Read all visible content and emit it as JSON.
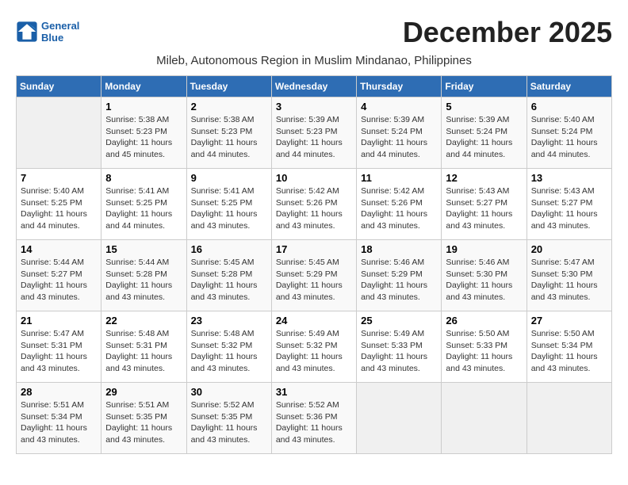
{
  "logo": {
    "line1": "General",
    "line2": "Blue"
  },
  "title": "December 2025",
  "subtitle": "Mileb, Autonomous Region in Muslim Mindanao, Philippines",
  "days_of_week": [
    "Sunday",
    "Monday",
    "Tuesday",
    "Wednesday",
    "Thursday",
    "Friday",
    "Saturday"
  ],
  "weeks": [
    [
      {
        "day": "",
        "info": ""
      },
      {
        "day": "1",
        "info": "Sunrise: 5:38 AM\nSunset: 5:23 PM\nDaylight: 11 hours\nand 45 minutes."
      },
      {
        "day": "2",
        "info": "Sunrise: 5:38 AM\nSunset: 5:23 PM\nDaylight: 11 hours\nand 44 minutes."
      },
      {
        "day": "3",
        "info": "Sunrise: 5:39 AM\nSunset: 5:23 PM\nDaylight: 11 hours\nand 44 minutes."
      },
      {
        "day": "4",
        "info": "Sunrise: 5:39 AM\nSunset: 5:24 PM\nDaylight: 11 hours\nand 44 minutes."
      },
      {
        "day": "5",
        "info": "Sunrise: 5:39 AM\nSunset: 5:24 PM\nDaylight: 11 hours\nand 44 minutes."
      },
      {
        "day": "6",
        "info": "Sunrise: 5:40 AM\nSunset: 5:24 PM\nDaylight: 11 hours\nand 44 minutes."
      }
    ],
    [
      {
        "day": "7",
        "info": "Sunrise: 5:40 AM\nSunset: 5:25 PM\nDaylight: 11 hours\nand 44 minutes."
      },
      {
        "day": "8",
        "info": "Sunrise: 5:41 AM\nSunset: 5:25 PM\nDaylight: 11 hours\nand 44 minutes."
      },
      {
        "day": "9",
        "info": "Sunrise: 5:41 AM\nSunset: 5:25 PM\nDaylight: 11 hours\nand 43 minutes."
      },
      {
        "day": "10",
        "info": "Sunrise: 5:42 AM\nSunset: 5:26 PM\nDaylight: 11 hours\nand 43 minutes."
      },
      {
        "day": "11",
        "info": "Sunrise: 5:42 AM\nSunset: 5:26 PM\nDaylight: 11 hours\nand 43 minutes."
      },
      {
        "day": "12",
        "info": "Sunrise: 5:43 AM\nSunset: 5:27 PM\nDaylight: 11 hours\nand 43 minutes."
      },
      {
        "day": "13",
        "info": "Sunrise: 5:43 AM\nSunset: 5:27 PM\nDaylight: 11 hours\nand 43 minutes."
      }
    ],
    [
      {
        "day": "14",
        "info": "Sunrise: 5:44 AM\nSunset: 5:27 PM\nDaylight: 11 hours\nand 43 minutes."
      },
      {
        "day": "15",
        "info": "Sunrise: 5:44 AM\nSunset: 5:28 PM\nDaylight: 11 hours\nand 43 minutes."
      },
      {
        "day": "16",
        "info": "Sunrise: 5:45 AM\nSunset: 5:28 PM\nDaylight: 11 hours\nand 43 minutes."
      },
      {
        "day": "17",
        "info": "Sunrise: 5:45 AM\nSunset: 5:29 PM\nDaylight: 11 hours\nand 43 minutes."
      },
      {
        "day": "18",
        "info": "Sunrise: 5:46 AM\nSunset: 5:29 PM\nDaylight: 11 hours\nand 43 minutes."
      },
      {
        "day": "19",
        "info": "Sunrise: 5:46 AM\nSunset: 5:30 PM\nDaylight: 11 hours\nand 43 minutes."
      },
      {
        "day": "20",
        "info": "Sunrise: 5:47 AM\nSunset: 5:30 PM\nDaylight: 11 hours\nand 43 minutes."
      }
    ],
    [
      {
        "day": "21",
        "info": "Sunrise: 5:47 AM\nSunset: 5:31 PM\nDaylight: 11 hours\nand 43 minutes."
      },
      {
        "day": "22",
        "info": "Sunrise: 5:48 AM\nSunset: 5:31 PM\nDaylight: 11 hours\nand 43 minutes."
      },
      {
        "day": "23",
        "info": "Sunrise: 5:48 AM\nSunset: 5:32 PM\nDaylight: 11 hours\nand 43 minutes."
      },
      {
        "day": "24",
        "info": "Sunrise: 5:49 AM\nSunset: 5:32 PM\nDaylight: 11 hours\nand 43 minutes."
      },
      {
        "day": "25",
        "info": "Sunrise: 5:49 AM\nSunset: 5:33 PM\nDaylight: 11 hours\nand 43 minutes."
      },
      {
        "day": "26",
        "info": "Sunrise: 5:50 AM\nSunset: 5:33 PM\nDaylight: 11 hours\nand 43 minutes."
      },
      {
        "day": "27",
        "info": "Sunrise: 5:50 AM\nSunset: 5:34 PM\nDaylight: 11 hours\nand 43 minutes."
      }
    ],
    [
      {
        "day": "28",
        "info": "Sunrise: 5:51 AM\nSunset: 5:34 PM\nDaylight: 11 hours\nand 43 minutes."
      },
      {
        "day": "29",
        "info": "Sunrise: 5:51 AM\nSunset: 5:35 PM\nDaylight: 11 hours\nand 43 minutes."
      },
      {
        "day": "30",
        "info": "Sunrise: 5:52 AM\nSunset: 5:35 PM\nDaylight: 11 hours\nand 43 minutes."
      },
      {
        "day": "31",
        "info": "Sunrise: 5:52 AM\nSunset: 5:36 PM\nDaylight: 11 hours\nand 43 minutes."
      },
      {
        "day": "",
        "info": ""
      },
      {
        "day": "",
        "info": ""
      },
      {
        "day": "",
        "info": ""
      }
    ]
  ]
}
